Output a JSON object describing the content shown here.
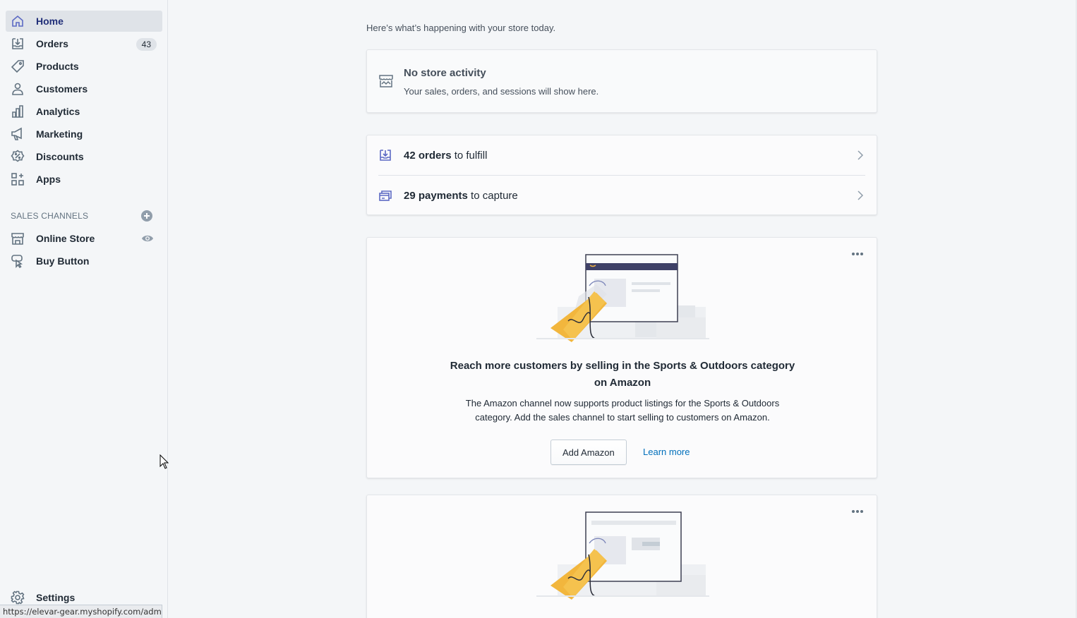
{
  "sidebar": {
    "nav": [
      {
        "label": "Home",
        "icon": "home-icon"
      },
      {
        "label": "Orders",
        "icon": "orders-icon",
        "badge": "43"
      },
      {
        "label": "Products",
        "icon": "tag-icon"
      },
      {
        "label": "Customers",
        "icon": "person-icon"
      },
      {
        "label": "Analytics",
        "icon": "bar-chart-icon"
      },
      {
        "label": "Marketing",
        "icon": "megaphone-icon"
      },
      {
        "label": "Discounts",
        "icon": "discount-icon"
      },
      {
        "label": "Apps",
        "icon": "apps-icon"
      }
    ],
    "sales_channels_heading": "SALES CHANNELS",
    "channels": [
      {
        "label": "Online Store",
        "icon": "store-icon"
      },
      {
        "label": "Buy Button",
        "icon": "buy-button-icon"
      }
    ],
    "settings_label": "Settings",
    "active": "Home",
    "accent_color": "#202e78"
  },
  "statusbar_url": "https://elevar-gear.myshopify.com/admin",
  "main": {
    "subtitle": "Here’s what’s happening with your store today.",
    "activity": {
      "title": "No store activity",
      "subtitle": "Your sales, orders, and sessions will show here."
    },
    "todos": [
      {
        "count": "42 orders",
        "text": " to fulfill"
      },
      {
        "count": "29 payments",
        "text": " to capture"
      }
    ],
    "promo": {
      "title_line1": "Reach more customers by selling in the Sports & Outdoors category",
      "title_line2": "on Amazon",
      "body_line1": "The Amazon channel now supports product listings for the Sports & Outdoors",
      "body_line2": "category. Add the sales channel to start selling to customers on Amazon.",
      "button_label": "Add Amazon",
      "link_label": "Learn more"
    }
  }
}
